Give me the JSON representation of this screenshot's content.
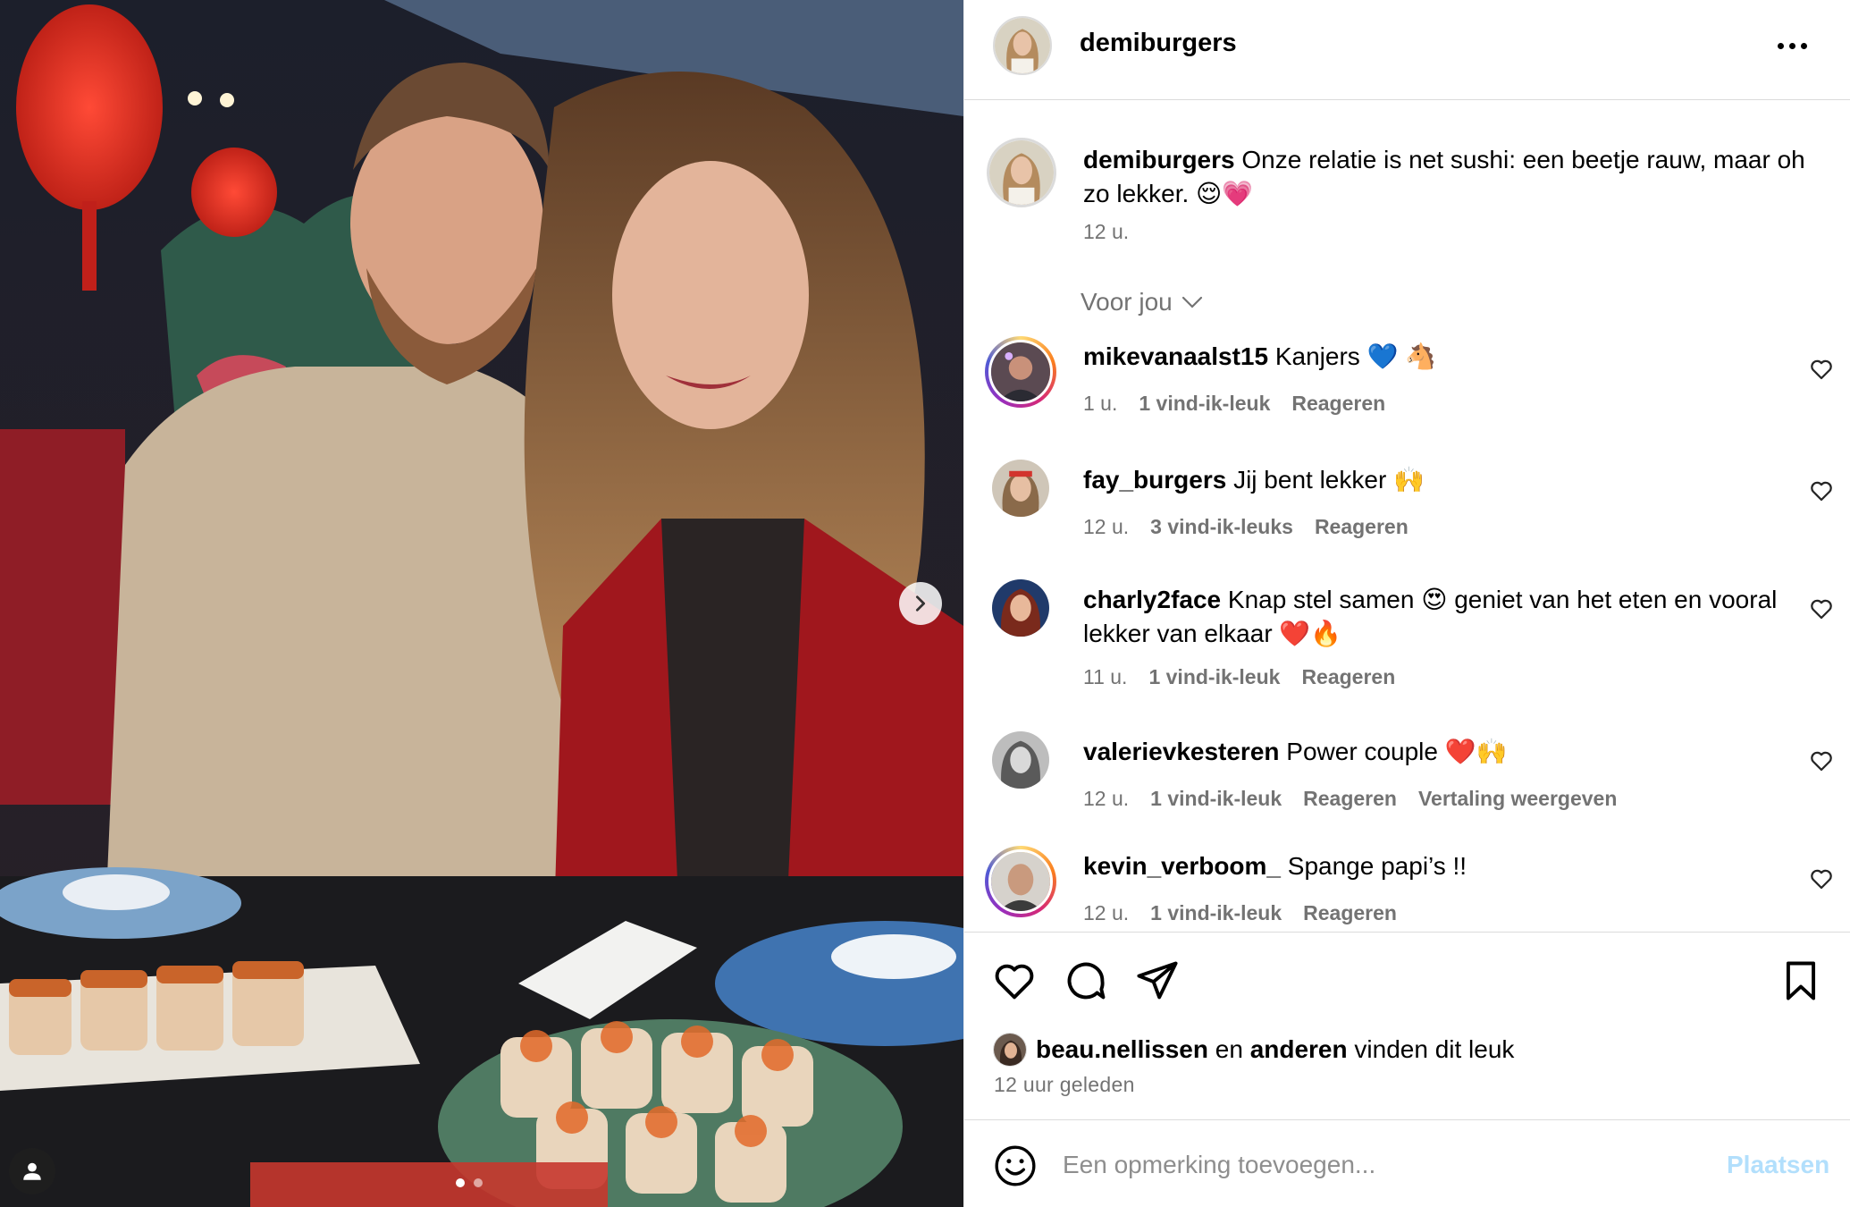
{
  "post": {
    "username": "demiburgers",
    "caption_text": " Onze relatie is net sushi: een beetje rauw, maar oh zo lekker. 😌💗",
    "caption_time": "12 u."
  },
  "sort_label": "Voor jou",
  "comments": [
    {
      "username": "mikevanaalst15",
      "text": " Kanjers 💙 🐴",
      "time": "1 u.",
      "likes": "1 vind-ik-leuk",
      "reply": "Reageren"
    },
    {
      "username": "fay_burgers",
      "text": " Jij bent lekker 🙌",
      "time": "12 u.",
      "likes": "3 vind-ik-leuks",
      "reply": "Reageren"
    },
    {
      "username": "charly2face",
      "text": " Knap stel samen 😍 geniet van het eten en vooral lekker van elkaar ❤️🔥",
      "time": "11 u.",
      "likes": "1 vind-ik-leuk",
      "reply": "Reageren"
    },
    {
      "username": "valerievkesteren",
      "text": " Power couple ❤️🙌",
      "time": "12 u.",
      "likes": "1 vind-ik-leuk",
      "reply": "Reageren",
      "translate": "Vertaling weergeven"
    },
    {
      "username": "kevin_verboom_",
      "text": " Spange papi’s !!",
      "time": "12 u.",
      "likes": "1 vind-ik-leuk",
      "reply": "Reageren"
    }
  ],
  "likes": {
    "user": "beau.nellissen",
    "connector": "en",
    "others": "anderen",
    "suffix": "vinden dit leuk"
  },
  "time_ago": "12 uur geleden",
  "comment_box": {
    "placeholder": "Een opmerking toevoegen...",
    "post_label": "Plaatsen"
  },
  "icons": {
    "more": "more-horizontal-icon",
    "chevron": "chevron-down-icon",
    "like": "heart-icon",
    "comment": "comment-icon",
    "share": "send-icon",
    "save": "bookmark-icon",
    "emoji": "emoji-icon",
    "next": "chevron-right-icon",
    "tags": "user-tag-icon"
  },
  "colors": {
    "secondary_text": "#737373",
    "post_button": "#b2dffc",
    "divider": "#dbdbdb"
  }
}
